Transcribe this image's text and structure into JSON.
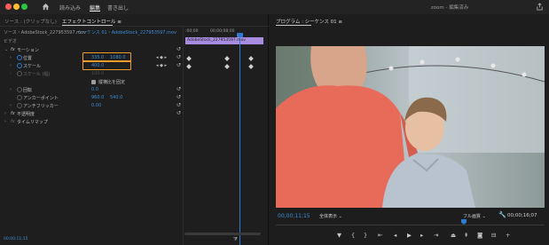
{
  "titlebar": {
    "workspaces": [
      "読み込み",
      "編集",
      "書き出し"
    ],
    "active_workspace": "編集",
    "app_title": "zoom - 編集済み"
  },
  "left_panel": {
    "tabs": [
      "ソース : (クリップなし)",
      "エフェクトコントロール ≡"
    ],
    "source_label": "ソース・AdobeStock_227953597.mov",
    "sequence_label": "シーケンス 01・AdobeStock_227953597.mov",
    "section": "ビデオ",
    "rows": {
      "motion": {
        "label": "モーション"
      },
      "position": {
        "label": "位置",
        "x": "335.0",
        "y": "1080.0"
      },
      "scale": {
        "label": "スケール",
        "value": "400.0"
      },
      "scale_width": {
        "label": "スケール (幅)",
        "value": "100.0"
      },
      "uniform": {
        "label": "縦横比を固定"
      },
      "rotation": {
        "label": "回転",
        "value": "0.0"
      },
      "anchor": {
        "label": "アンカーポイント",
        "x": "960.0",
        "y": "540.0"
      },
      "antiflicker": {
        "label": "アンチフリッカー",
        "value": "0.00"
      },
      "opacity": {
        "label": "不透明度"
      },
      "remap": {
        "label": "タイムリマップ"
      }
    },
    "ruler": {
      "start": ":00;00",
      "end": "00;00;08;00"
    },
    "clip_name": "AdobeStock_227953597.mov",
    "bottom_timecode": "00;00;11;15"
  },
  "right_panel": {
    "title": "プログラム : シーケンス 01 ≡",
    "current_timecode": "00;00;11;15",
    "fit": "全体表示",
    "quality": "フル画質",
    "duration": "00;00;16;07"
  },
  "colors": {
    "accent": "#2f7ad0",
    "highlight": "#f09b2a",
    "clip": "#a78ce0"
  }
}
